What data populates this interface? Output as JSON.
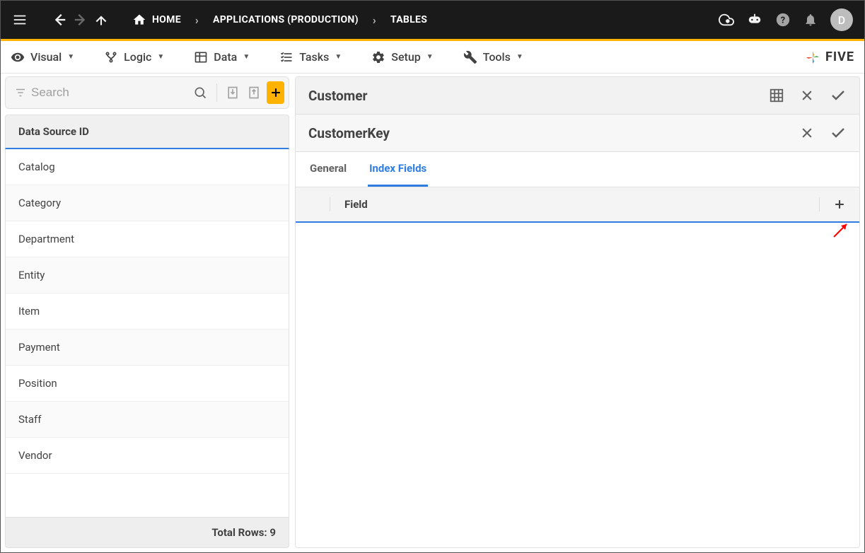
{
  "topbar": {
    "breadcrumbs": [
      {
        "label": "HOME"
      },
      {
        "label": "APPLICATIONS (PRODUCTION)"
      },
      {
        "label": "TABLES"
      }
    ],
    "avatar_letter": "D"
  },
  "menubar": {
    "items": [
      {
        "label": "Visual"
      },
      {
        "label": "Logic"
      },
      {
        "label": "Data"
      },
      {
        "label": "Tasks"
      },
      {
        "label": "Setup"
      },
      {
        "label": "Tools"
      }
    ],
    "brand": "FIVE"
  },
  "sidebar": {
    "search_placeholder": "Search",
    "header_label": "Data Source ID",
    "items": [
      "Catalog",
      "Category",
      "Department",
      "Entity",
      "Item",
      "Payment",
      "Position",
      "Staff",
      "Vendor"
    ],
    "footer_label": "Total Rows: 9"
  },
  "detail": {
    "title": "Customer",
    "subtitle": "CustomerKey",
    "tabs": {
      "general": "General",
      "index_fields": "Index Fields"
    },
    "active_tab": "index_fields",
    "field_column_label": "Field"
  }
}
